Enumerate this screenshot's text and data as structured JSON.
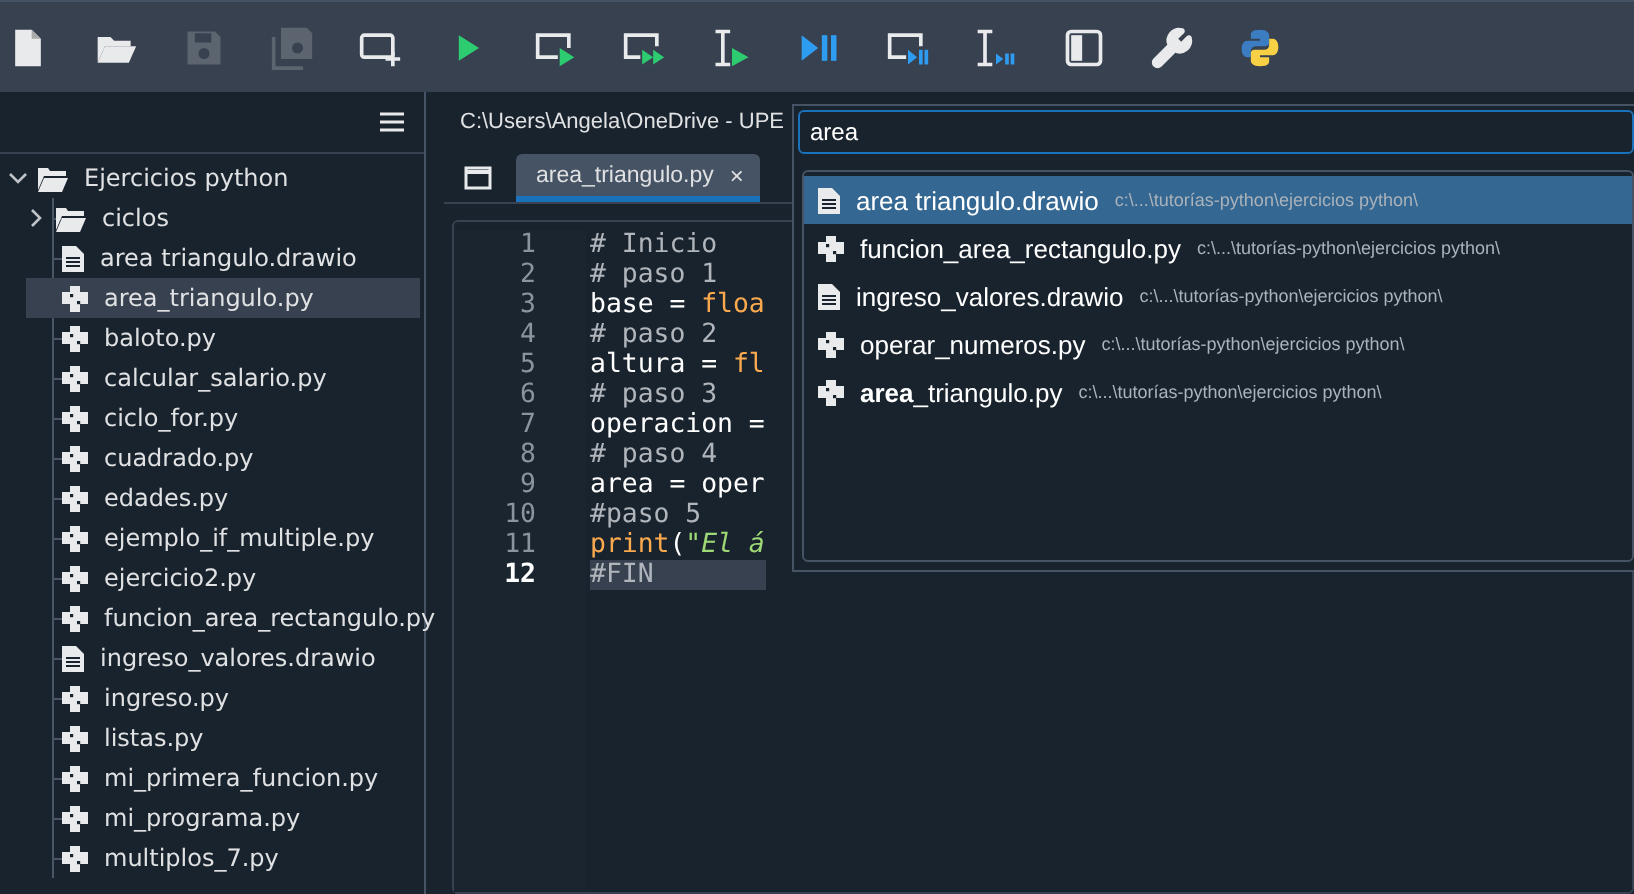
{
  "toolbar": [
    {
      "kind": "new-file",
      "disabled": false
    },
    {
      "kind": "open-folder",
      "disabled": false
    },
    {
      "kind": "save",
      "disabled": true
    },
    {
      "kind": "save-all",
      "disabled": true
    },
    {
      "kind": "new-cell",
      "disabled": false
    },
    {
      "kind": "run",
      "disabled": false
    },
    {
      "kind": "run-cell",
      "disabled": false
    },
    {
      "kind": "run-cell-advance",
      "disabled": false
    },
    {
      "kind": "run-selection",
      "disabled": false
    },
    {
      "kind": "debug",
      "disabled": false
    },
    {
      "kind": "debug-cell",
      "disabled": false
    },
    {
      "kind": "debug-selection",
      "disabled": false
    },
    {
      "kind": "maximize-pane",
      "disabled": false
    },
    {
      "kind": "preferences",
      "disabled": false
    },
    {
      "kind": "python-path",
      "disabled": false
    }
  ],
  "file_tree": {
    "items": [
      {
        "label": "Ejercicios python",
        "kind": "folder",
        "expanded": true,
        "selected": false,
        "children": [
          {
            "label": "ciclos",
            "kind": "folder",
            "expanded": false,
            "selected": false
          },
          {
            "label": "area triangulo.drawio",
            "kind": "drawio",
            "selected": false
          },
          {
            "label": "area_triangulo.py",
            "kind": "py",
            "selected": true
          },
          {
            "label": "baloto.py",
            "kind": "py",
            "selected": false
          },
          {
            "label": "calcular_salario.py",
            "kind": "py",
            "selected": false
          },
          {
            "label": "ciclo_for.py",
            "kind": "py",
            "selected": false
          },
          {
            "label": "cuadrado.py",
            "kind": "py",
            "selected": false
          },
          {
            "label": "edades.py",
            "kind": "py",
            "selected": false
          },
          {
            "label": "ejemplo_if_multiple.py",
            "kind": "py",
            "selected": false
          },
          {
            "label": "ejercicio2.py",
            "kind": "py",
            "selected": false
          },
          {
            "label": "funcion_area_rectangulo.py",
            "kind": "py",
            "selected": false
          },
          {
            "label": "ingreso_valores.drawio",
            "kind": "drawio",
            "selected": false
          },
          {
            "label": "ingreso.py",
            "kind": "py",
            "selected": false
          },
          {
            "label": "listas.py",
            "kind": "py",
            "selected": false
          },
          {
            "label": "mi_primera_funcion.py",
            "kind": "py",
            "selected": false
          },
          {
            "label": "mi_programa.py",
            "kind": "py",
            "selected": false
          },
          {
            "label": "multiplos_7.py",
            "kind": "py",
            "selected": false
          }
        ]
      }
    ]
  },
  "editor": {
    "path": "C:\\Users\\Angela\\OneDrive - UPE",
    "tabs": [
      {
        "label": "area_triangulo.py",
        "close": "×",
        "selected": true
      }
    ],
    "lines": [
      {
        "number": "1",
        "current": false,
        "tokens": [
          {
            "kind": "comment",
            "text": "# Inicio"
          }
        ]
      },
      {
        "number": "2",
        "current": false,
        "tokens": [
          {
            "kind": "comment",
            "text": "# paso 1"
          }
        ]
      },
      {
        "number": "3",
        "current": false,
        "tokens": [
          {
            "kind": "plain",
            "text": "base = "
          },
          {
            "kind": "builtin",
            "text": "floa"
          }
        ]
      },
      {
        "number": "4",
        "current": false,
        "tokens": [
          {
            "kind": "comment",
            "text": "# paso 2"
          }
        ]
      },
      {
        "number": "5",
        "current": false,
        "tokens": [
          {
            "kind": "plain",
            "text": "altura = "
          },
          {
            "kind": "builtin",
            "text": "fl"
          }
        ]
      },
      {
        "number": "6",
        "current": false,
        "tokens": [
          {
            "kind": "comment",
            "text": "# paso 3"
          }
        ]
      },
      {
        "number": "7",
        "current": false,
        "tokens": [
          {
            "kind": "plain",
            "text": "operacion ="
          }
        ]
      },
      {
        "number": "8",
        "current": false,
        "tokens": [
          {
            "kind": "comment",
            "text": "# paso 4"
          }
        ]
      },
      {
        "number": "9",
        "current": false,
        "tokens": [
          {
            "kind": "plain",
            "text": "area = oper"
          }
        ]
      },
      {
        "number": "10",
        "current": false,
        "tokens": [
          {
            "kind": "comment",
            "text": "#paso 5"
          }
        ]
      },
      {
        "number": "11",
        "current": false,
        "tokens": [
          {
            "kind": "builtin",
            "text": "print"
          },
          {
            "kind": "plain",
            "text": "("
          },
          {
            "kind": "string",
            "text": "\"El á"
          }
        ]
      },
      {
        "number": "12",
        "current": true,
        "tokens": [
          {
            "kind": "comment",
            "text": "#FIN"
          }
        ]
      }
    ]
  },
  "file_switcher": {
    "query": "area",
    "results": [
      {
        "name": "area triangulo.drawio",
        "kind": "drawio",
        "path": "c:\\...\\tutorías-python\\ejercicios python\\",
        "selected": true
      },
      {
        "name": "funcion_area_rectangulo.py",
        "kind": "py",
        "path": "c:\\...\\tutorías-python\\ejercicios python\\",
        "selected": false
      },
      {
        "name": "ingreso_valores.drawio",
        "kind": "drawio",
        "path": "c:\\...\\tutorías-python\\ejercicios python\\",
        "selected": false
      },
      {
        "name": "operar_numeros.py",
        "kind": "py",
        "path": "c:\\...\\tutorías-python\\ejercicios python\\",
        "selected": false
      },
      {
        "name": "**area**_triangulo.py",
        "kind": "py",
        "path": "c:\\...\\tutorías-python\\ejercicios python\\",
        "selected": false
      }
    ]
  }
}
